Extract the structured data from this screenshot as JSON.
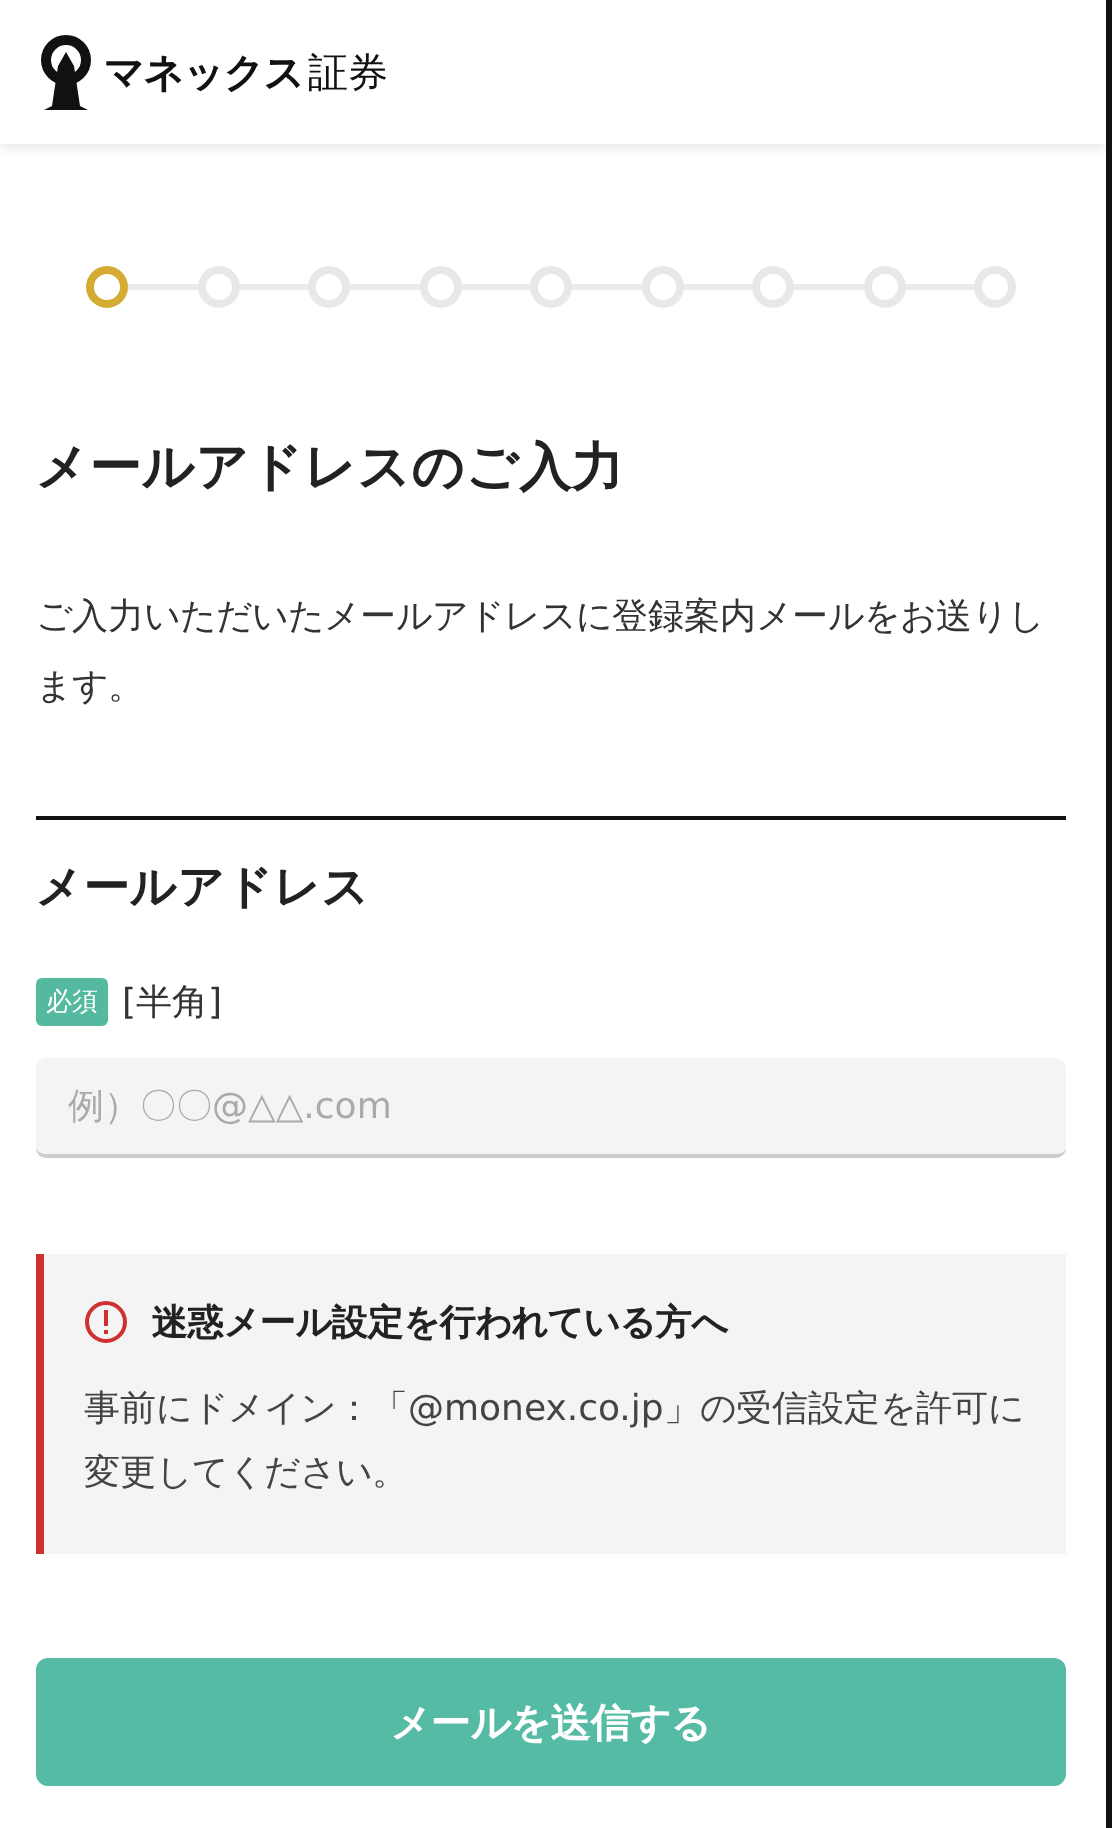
{
  "header": {
    "logo_brand": "マネックス",
    "logo_suffix": "証券"
  },
  "steps": [
    {
      "selected": true
    },
    {
      "selected": false
    },
    {
      "selected": false
    },
    {
      "selected": false
    },
    {
      "selected": false
    },
    {
      "selected": false
    },
    {
      "selected": false
    },
    {
      "selected": false
    },
    {
      "selected": false
    }
  ],
  "title": "メールアドレスのご入力",
  "description": "ご入力いただいたメールアドレスに登録案内メールをお送りします。",
  "section_title": "メールアドレス",
  "required_badge": "必須",
  "format_note": "[半角]",
  "email_field": {
    "placeholder": "例）〇〇@△△.com"
  },
  "notice": {
    "title": "迷惑メール設定を行われている方へ",
    "body": "事前にドメイン：「@monex.co.jp」の受信設定を許可に変更してください。"
  },
  "submit_button": "メールを送信する"
}
